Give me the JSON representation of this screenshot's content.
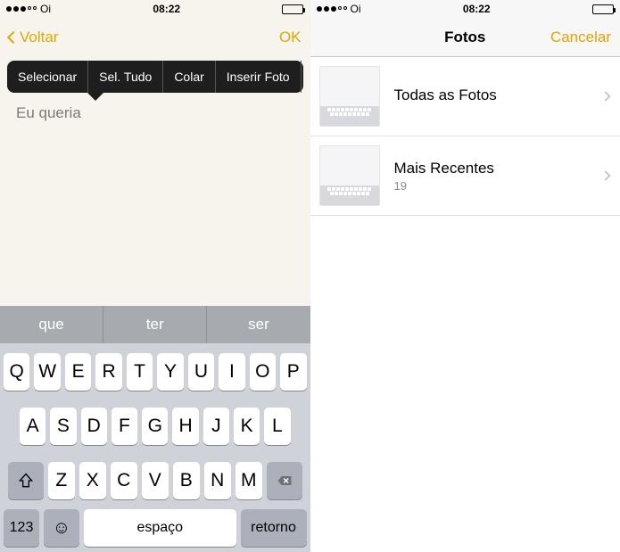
{
  "left": {
    "status": {
      "carrier": "Oi",
      "time": "08:22"
    },
    "nav": {
      "back": "Voltar",
      "ok": "OK"
    },
    "context_menu": [
      "Selecionar",
      "Sel. Tudo",
      "Colar",
      "Inserir Foto"
    ],
    "note_text": "Eu queria",
    "suggestions": [
      "que",
      "ter",
      "ser"
    ],
    "keys_row1": [
      "Q",
      "W",
      "E",
      "R",
      "T",
      "Y",
      "U",
      "I",
      "O",
      "P"
    ],
    "keys_row2": [
      "A",
      "S",
      "D",
      "F",
      "G",
      "H",
      "J",
      "K",
      "L"
    ],
    "keys_row3": [
      "Z",
      "X",
      "C",
      "V",
      "B",
      "N",
      "M"
    ],
    "key_numbers": "123",
    "key_space": "espaço",
    "key_return": "retorno"
  },
  "right": {
    "status": {
      "carrier": "Oi",
      "time": "08:22"
    },
    "nav": {
      "title": "Fotos",
      "cancel": "Cancelar"
    },
    "albums": [
      {
        "title": "Todas as Fotos",
        "count": ""
      },
      {
        "title": "Mais Recentes",
        "count": "19"
      }
    ]
  }
}
